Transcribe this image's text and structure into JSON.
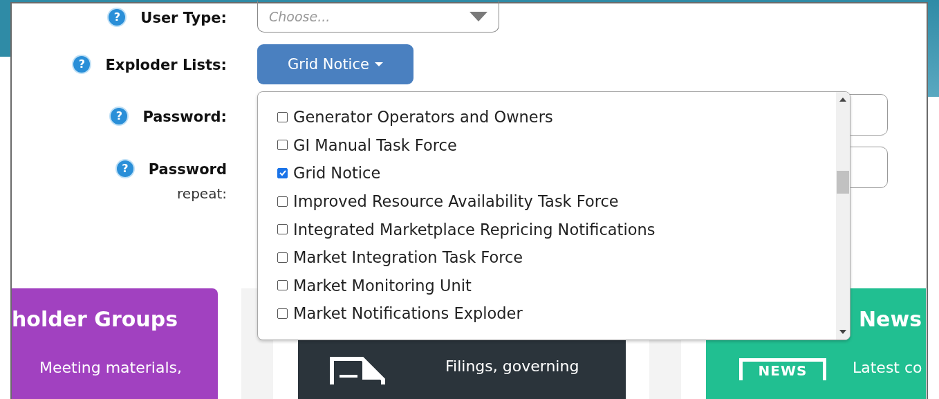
{
  "form": {
    "rows": [
      {
        "kind": "select",
        "help": "?",
        "label": "User Type:",
        "placeholder": "Choose..."
      },
      {
        "kind": "dropdown",
        "help": "?",
        "label": "Exploder Lists:",
        "button": "Grid Notice"
      },
      {
        "kind": "password",
        "help": "?",
        "label": "Password:"
      },
      {
        "kind": "password",
        "help": "?",
        "label": "Password",
        "sublabel": "repeat:"
      }
    ]
  },
  "exploder_menu": {
    "items": [
      {
        "label": "Generator Operators and Owners",
        "checked": false
      },
      {
        "label": "GI Manual Task Force",
        "checked": false
      },
      {
        "label": "Grid Notice",
        "checked": true
      },
      {
        "label": "Improved Resource Availability Task Force",
        "checked": false
      },
      {
        "label": "Integrated Marketplace Repricing Notifications",
        "checked": false
      },
      {
        "label": "Market Integration Task Force",
        "checked": false
      },
      {
        "label": "Market Monitoring Unit",
        "checked": false
      },
      {
        "label": "Market Notifications Exploder",
        "checked": false
      }
    ]
  },
  "cards": [
    {
      "kind": "plain",
      "title": "holder Groups",
      "text": "Meeting materials,",
      "color": "#a141c0"
    },
    {
      "kind": "documents",
      "text": "Filings, governing",
      "color": "#2b343b"
    },
    {
      "kind": "news",
      "title": "News",
      "badge": "NEWS",
      "text": "Latest co",
      "color": "#21bf91"
    }
  ]
}
